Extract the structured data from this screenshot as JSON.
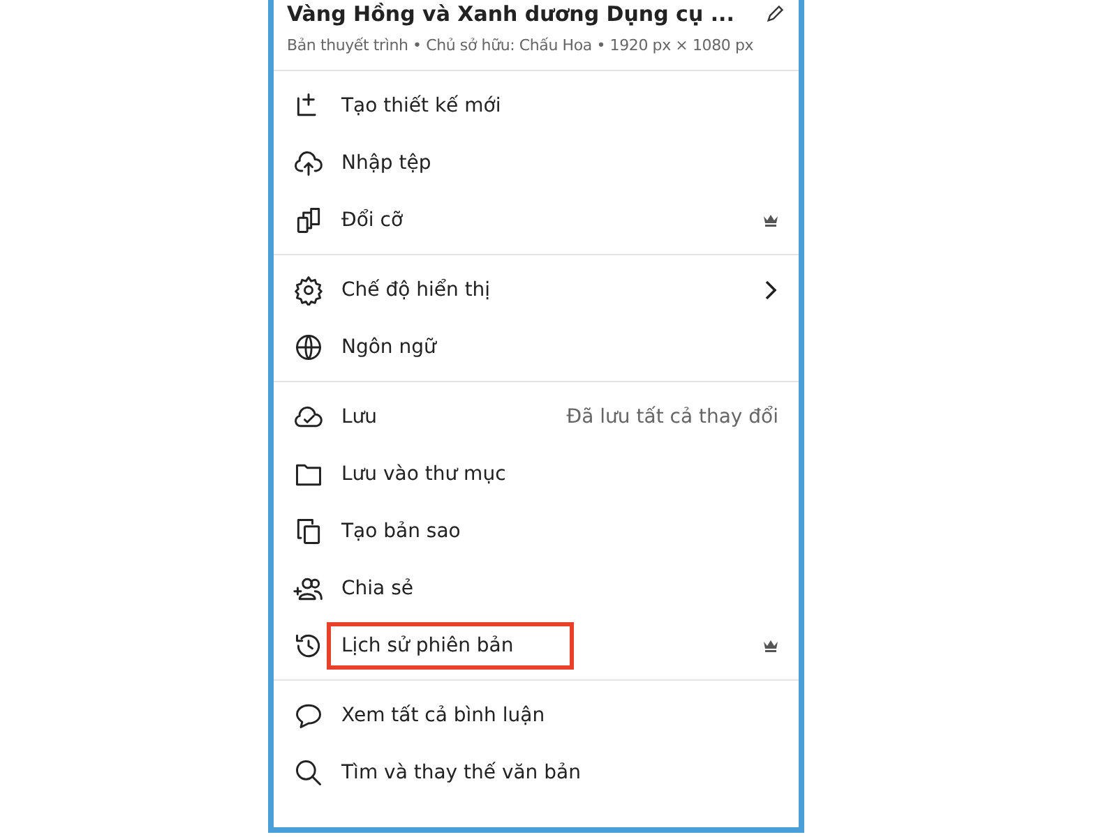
{
  "header": {
    "title": "Vàng Hồng và Xanh dương Dụng cụ ...",
    "meta": "Bản thuyết trình • Chủ sở hữu: Chấu Hoa • 1920 px × 1080 px"
  },
  "sections": [
    {
      "items": [
        {
          "label": "Tạo thiết kế mới",
          "kind": "plain",
          "highlighted": false
        },
        {
          "label": "Nhập tệp",
          "kind": "plain",
          "highlighted": false
        },
        {
          "label": "Đổi cỡ",
          "kind": "premium",
          "highlighted": false
        }
      ]
    },
    {
      "items": [
        {
          "label": "Chế độ hiển thị",
          "kind": "submenu",
          "highlighted": false
        },
        {
          "label": "Ngôn ngữ",
          "kind": "plain",
          "highlighted": false
        }
      ]
    },
    {
      "items": [
        {
          "label": "Lưu",
          "kind": "status",
          "status": "Đã lưu tất cả thay đổi",
          "highlighted": false
        },
        {
          "label": "Lưu vào thư mục",
          "kind": "plain",
          "highlighted": false
        },
        {
          "label": "Tạo bản sao",
          "kind": "plain",
          "highlighted": false
        },
        {
          "label": "Chia sẻ",
          "kind": "plain",
          "highlighted": false
        },
        {
          "label": "Lịch sử phiên bản",
          "kind": "premium",
          "highlighted": true
        }
      ]
    },
    {
      "items": [
        {
          "label": "Xem tất cả bình luận",
          "kind": "plain",
          "highlighted": false
        },
        {
          "label": "Tìm và thay thế văn bản",
          "kind": "plain",
          "highlighted": false
        }
      ]
    }
  ]
}
